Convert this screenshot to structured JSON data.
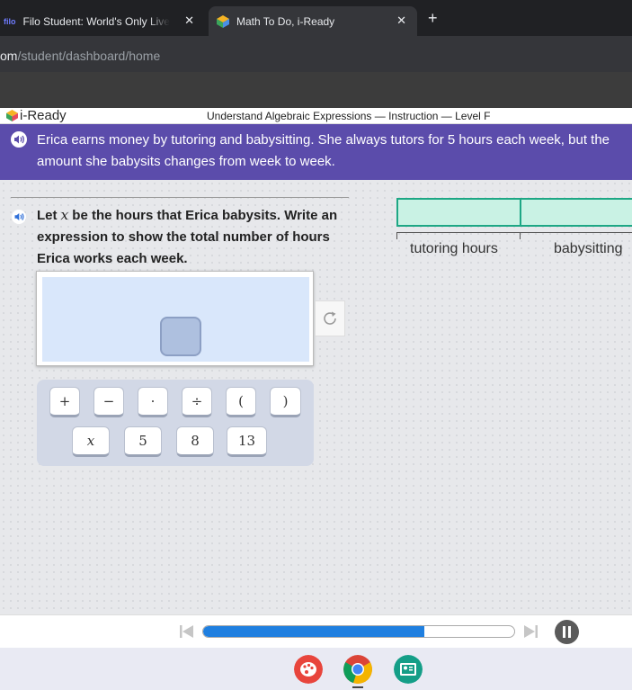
{
  "browser": {
    "tabs": [
      {
        "favicon_text": "filo",
        "title": "Filo Student: World's Only Live Instant",
        "close": "✕"
      },
      {
        "title": "Math To Do, i-Ready",
        "close": "✕"
      }
    ],
    "new_tab": "+",
    "url_host": "om",
    "url_path": "/student/dashboard/home"
  },
  "header": {
    "logo": "i-Ready",
    "lesson_title": "Understand Algebraic Expressions — Instruction — Level F"
  },
  "banner": {
    "text": "Erica earns money by tutoring and babysitting. She always tutors for 5 hours each week, but the amount she babysits changes from week to week."
  },
  "question": {
    "part1": "Let ",
    "variable": "x",
    "part2": " be the hours that Erica babysits. Write an expression to show the total number of hours Erica works each week."
  },
  "bar_model": {
    "labels": [
      "tutoring hours",
      "babysitting"
    ]
  },
  "keypad": {
    "row1": [
      "+",
      "−",
      "·",
      "÷",
      "(",
      ")"
    ],
    "row2": [
      "x",
      "5",
      "8",
      "13"
    ]
  },
  "player": {
    "progress": 0.71
  },
  "colors": {
    "banner": "#5b4cab",
    "bar_fill": "#c9f2e4",
    "bar_border": "#1ea785",
    "progress": "#1f7fe0"
  },
  "icons": [
    "speaker-icon",
    "reset-icon",
    "skip-back-icon",
    "skip-forward-icon",
    "pause-icon",
    "palette-app-icon",
    "chrome-app-icon",
    "classroom-app-icon"
  ]
}
